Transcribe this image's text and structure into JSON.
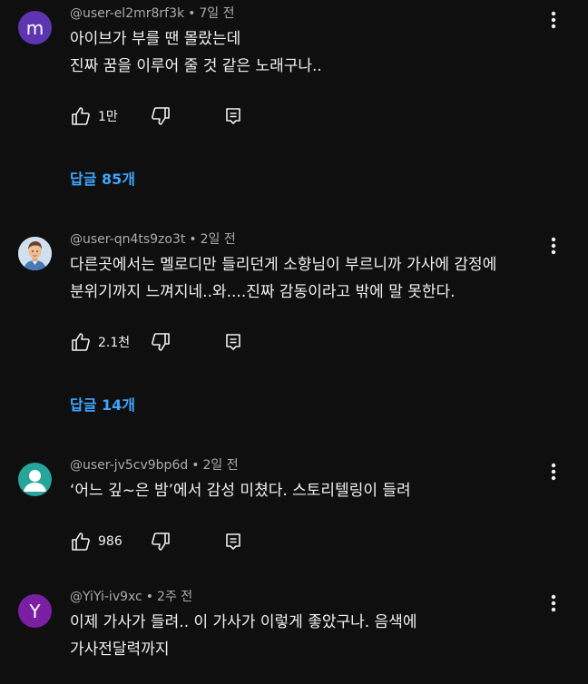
{
  "comments": [
    {
      "author": "@user-el2mr8rf3k",
      "time": "7일 전",
      "avatar_letter": "m",
      "avatar_color": "#5e35b1",
      "lines": [
        "아이브가 부를 땐 몰랐는데",
        "진짜 꿈을 이루어 줄 것 같은 노래구나.."
      ],
      "likes": "1만",
      "replies": "답글 85개"
    },
    {
      "author": "@user-qn4ts9zo3t",
      "time": "2일 전",
      "avatar_letter": "",
      "avatar_color": "#c9d8e8",
      "lines": [
        "다른곳에서는 멜로디만 들리던게 소향님이 부르니까 가사에 감정에",
        "분위기까지 느껴지네..와....진짜 감동이라고 밖에 말 못한다."
      ],
      "likes": "2.1천",
      "replies": "답글 14개"
    },
    {
      "author": "@user-jv5cv9bp6d",
      "time": "2일 전",
      "avatar_letter": "",
      "avatar_color": "#26a69a",
      "lines": [
        "‘어느 깊~은 밤’에서 감성 미쳤다. 스토리텔링이 들려"
      ],
      "likes": "986",
      "replies": ""
    },
    {
      "author": "@YiYi-iv9xc",
      "time": "2주 전",
      "avatar_letter": "Y",
      "avatar_color": "#7b1fa2",
      "lines": [
        "이제 가사가 들려.. 이 가사가 이렇게 좋았구나. 음색에",
        "가사전달력까지"
      ],
      "likes": "",
      "replies": ""
    }
  ],
  "separator": "•",
  "colors": {
    "background": "#0f0f0f",
    "text": "#f1f1f1",
    "meta": "#aaaaaa",
    "link": "#3ea6ff"
  },
  "icons": [
    "like-icon",
    "dislike-icon",
    "reply-icon",
    "more-vert-icon",
    "default-avatar-icon"
  ]
}
